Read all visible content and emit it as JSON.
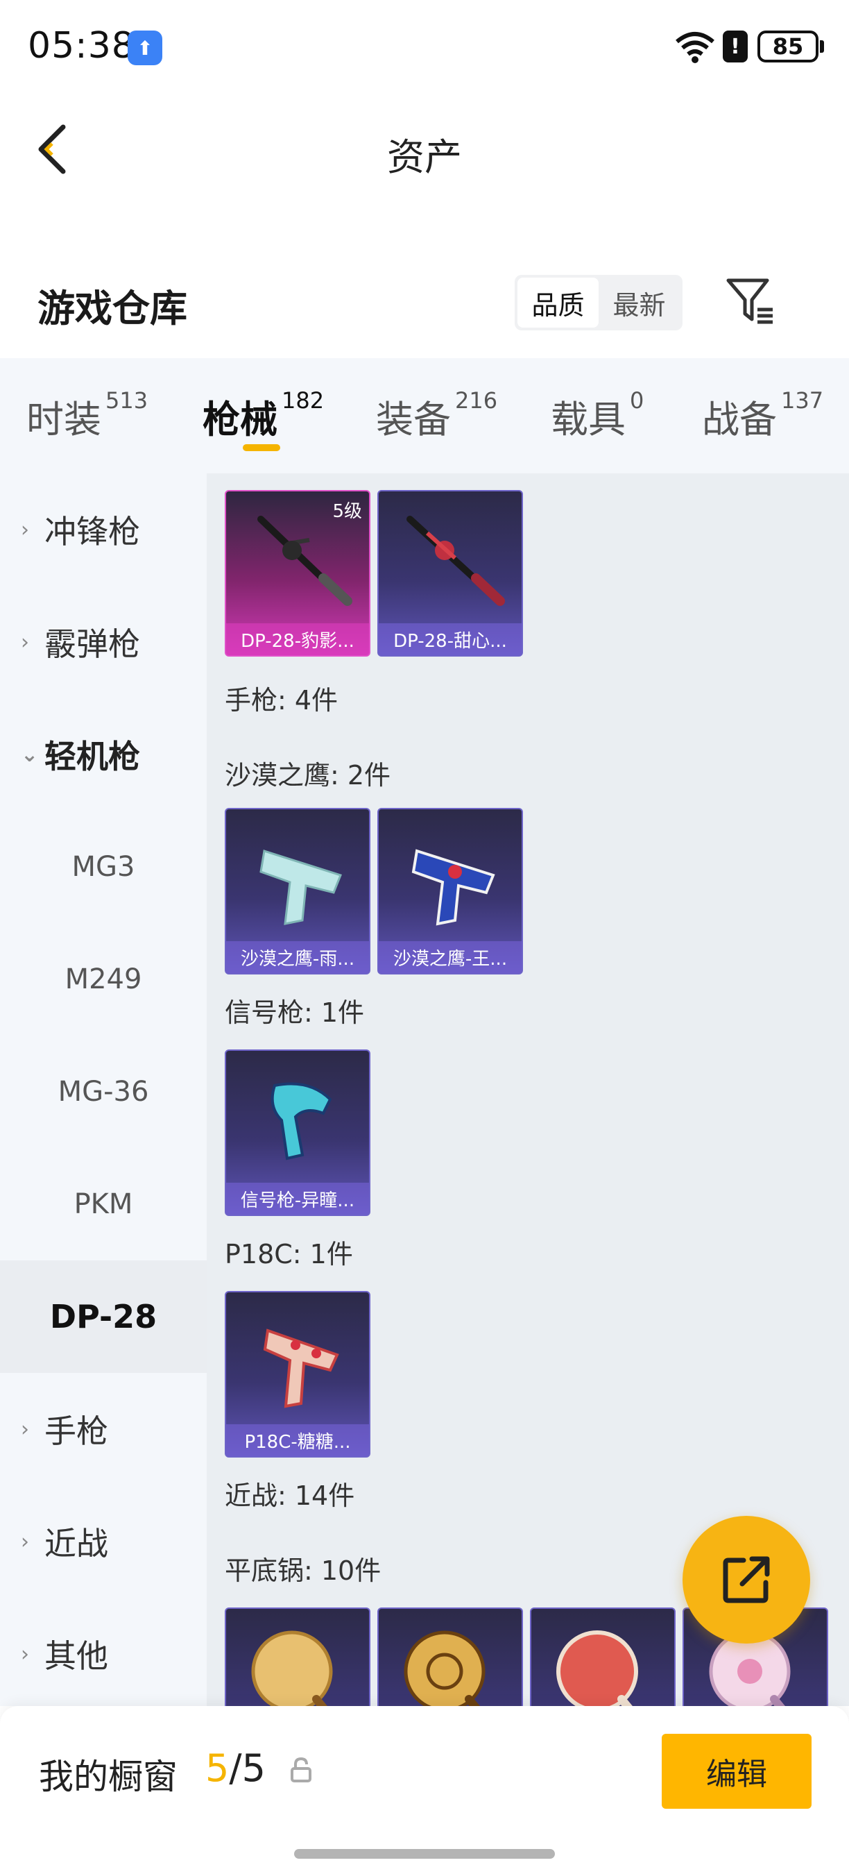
{
  "status_bar": {
    "time": "05:38",
    "battery": "85",
    "alert_glyph": "!",
    "app_glyph": "⬆"
  },
  "header": {
    "title": "资产",
    "back_icon": "chevron-left-icon"
  },
  "warehouse": {
    "title": "游戏仓库",
    "sort_options": [
      "品质",
      "最新"
    ],
    "selected_sort": "品质",
    "filter_icon": "filter-icon"
  },
  "tabs": [
    {
      "label": "时装",
      "count": "513"
    },
    {
      "label": "枪械",
      "count": "182"
    },
    {
      "label": "装备",
      "count": "216"
    },
    {
      "label": "载具",
      "count": "0"
    },
    {
      "label": "战备",
      "count": "137"
    }
  ],
  "active_tab": "枪械",
  "sidebar": {
    "items": [
      {
        "label": "冲锋枪",
        "type": "parent"
      },
      {
        "label": "霰弹枪",
        "type": "parent"
      },
      {
        "label": "轻机枪",
        "type": "parent",
        "open": true
      },
      {
        "label": "MG3",
        "type": "child"
      },
      {
        "label": "M249",
        "type": "child"
      },
      {
        "label": "MG-36",
        "type": "child"
      },
      {
        "label": "PKM",
        "type": "child"
      },
      {
        "label": "DP-28",
        "type": "child",
        "active": true
      },
      {
        "label": "手枪",
        "type": "parent"
      },
      {
        "label": "近战",
        "type": "parent"
      },
      {
        "label": "其他",
        "type": "parent"
      }
    ]
  },
  "content": {
    "dp28_cards": [
      {
        "name": "DP-28-豹影...",
        "level": "5级",
        "rarity": "gold"
      },
      {
        "name": "DP-28-甜心...",
        "rarity": "purple"
      }
    ],
    "pistol_group": "手枪: 4件",
    "deagle_group": "沙漠之鹰: 2件",
    "deagle_cards": [
      {
        "name": "沙漠之鹰-雨..."
      },
      {
        "name": "沙漠之鹰-王..."
      }
    ],
    "flare_group": "信号枪: 1件",
    "flare_cards": [
      {
        "name": "信号枪-异瞳..."
      }
    ],
    "p18c_group": "P18C: 1件",
    "p18c_cards": [
      {
        "name": "P18C-糖糖..."
      }
    ],
    "melee_group": "近战: 14件",
    "pan_group": "平底锅: 10件"
  },
  "fab_icon": "share-external-icon",
  "bottom_bar": {
    "label": "我的橱窗",
    "current": "5",
    "separator": "/",
    "total": "5",
    "lock_icon": "lock-icon",
    "edit_label": "编辑"
  },
  "colors": {
    "accent": "#f5b400",
    "button": "#ffb600",
    "gold_card": "#d33bb8",
    "purple_card": "#5f55b8"
  }
}
